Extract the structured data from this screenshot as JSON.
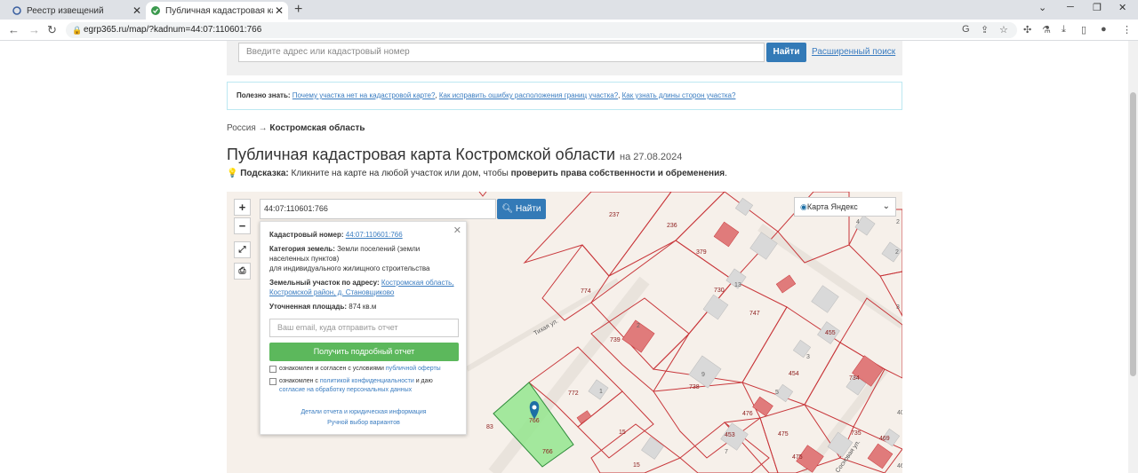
{
  "browser": {
    "tabs": [
      {
        "label": "Реестр извещений",
        "active": false
      },
      {
        "label": "Публичная кадастровая карта К",
        "active": true
      }
    ],
    "url": "egrp365.ru/map/?kadnum=44:07:110601:766"
  },
  "search": {
    "placeholder": "Введите адрес или кадастровый номер",
    "button": "Найти",
    "advanced": "Расширенный поиск"
  },
  "useful": {
    "label": "Полезно знать:",
    "links": [
      "Почему участка нет на кадастровой карте?",
      "Как исправить ошибку расположения границ участка?",
      "Как узнать длины сторон участка?"
    ]
  },
  "breadcrumbs": {
    "root": "Россия",
    "sep": "→",
    "current": "Костромская область"
  },
  "page": {
    "title": "Публичная кадастровая карта Костромской области",
    "date": "на 27.08.2024"
  },
  "hint": {
    "label": "Подсказка:",
    "text": "Кликните на карте на любой участок или дом, чтобы",
    "bold": "проверить права собственности и обременения",
    "end": "."
  },
  "map": {
    "search_value": "44:07:110601:766",
    "search_button": "Найти",
    "layer": "Карта Яндекс",
    "street": "Тихая ул.",
    "street2": "Сосновая ул.",
    "labels": [
      "237",
      "236",
      "379",
      "774",
      "730",
      "747",
      "739",
      "738",
      "772",
      "455",
      "454",
      "734",
      "476",
      "475",
      "475",
      "453",
      "735",
      "469",
      "15",
      "15",
      "83",
      "766",
      "13",
      "9",
      "1",
      "2",
      "3",
      "4",
      "2",
      "3",
      "7",
      "5",
      "4",
      "6",
      "40",
      "46"
    ]
  },
  "popup": {
    "cad_label": "Кадастровый номер:",
    "cad_value": "44:07:110601:766",
    "cat_label": "Категория земель:",
    "cat_value": "Земли поселений (земли населенных пунктов)",
    "cat_use": "для индивидуального жилищного строительства",
    "addr_label": "Земельный участок по адресу:",
    "addr_value": "Костромская область, Костромской район, д. Становщиково",
    "area_label": "Уточненная площадь:",
    "area_value": "874 кв.м",
    "email_placeholder": "Ваш email, куда отправить отчет",
    "get_button": "Получить подробный отчет",
    "check1_text": "ознакомлен и согласен с условиями",
    "check1_link": "публичной оферты",
    "check2_text": "ознакомлен с",
    "check2_link1": "политикой конфиденциальности",
    "check2_mid": "и даю",
    "check2_link2": "согласие на обработку персональных данных",
    "link1": "Детали отчета и юридическая информация",
    "link2": "Ручной выбор вариантов"
  }
}
